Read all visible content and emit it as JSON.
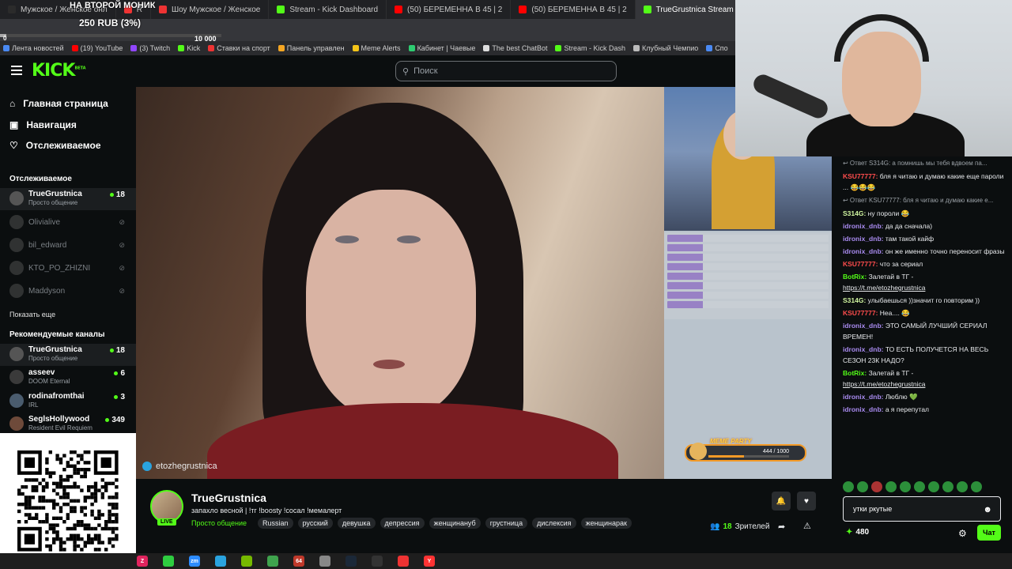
{
  "browser": {
    "tabs": [
      {
        "label": "Мужское / Женское онл",
        "fav_color": "#2b2b2b"
      },
      {
        "label": "R",
        "fav_color": "#e33"
      },
      {
        "label": "Шоу Мужское / Женское",
        "fav_color": "#e33"
      },
      {
        "label": "Stream - Kick Dashboard",
        "fav_color": "#53fc18"
      },
      {
        "label": "(50) БЕРЕМЕННА В 45 | 2",
        "fav_color": "#ff0000"
      },
      {
        "label": "(50) БЕРЕМЕННА В 45 | 2",
        "fav_color": "#ff0000"
      },
      {
        "label": "TrueGrustnica Stream",
        "fav_color": "#53fc18",
        "active": true
      }
    ],
    "bookmarks": [
      {
        "label": "Лента новостей",
        "color": "#4a8af4"
      },
      {
        "label": "(19) YouTube",
        "color": "#ff0000"
      },
      {
        "label": "(3) Twitch",
        "color": "#9146ff"
      },
      {
        "label": "Kick",
        "color": "#53fc18"
      },
      {
        "label": "Ставки на спорт",
        "color": "#e33"
      },
      {
        "label": "Панель управлен",
        "color": "#f5a623"
      },
      {
        "label": "Meme Alerts",
        "color": "#f5c518"
      },
      {
        "label": "Кабинет | Чаевые",
        "color": "#2ecc71"
      },
      {
        "label": "The best ChatBot",
        "color": "#ddd"
      },
      {
        "label": "Stream - Kick Dash",
        "color": "#53fc18"
      },
      {
        "label": "Клубный Чемпио",
        "color": "#bbb"
      },
      {
        "label": "Спо",
        "color": "#4a8af4"
      }
    ]
  },
  "donation": {
    "title": "НА ВТОРОЙ МОНИК",
    "amount": "250 RUB (3%)",
    "min": "0",
    "max": "10 000",
    "progress": 0.03
  },
  "header": {
    "logo": "KICK",
    "logo_sup": "BETA",
    "search_placeholder": "Поиск"
  },
  "sidebar": {
    "nav": [
      "Главная страница",
      "Навигация",
      "Отслеживаемое"
    ],
    "following_title": "Отслеживаемое",
    "following": [
      {
        "name": "TrueGrustnica",
        "category": "Просто общение",
        "viewers": "18",
        "live": true
      },
      {
        "name": "Olivialive",
        "live": false
      },
      {
        "name": "bil_edward",
        "live": false
      },
      {
        "name": "KTO_PO_ZHIZNI",
        "live": false
      },
      {
        "name": "Maddyson",
        "live": false
      }
    ],
    "show_more": "Показать еще",
    "recommended_title": "Рекомендуемые каналы",
    "recommended": [
      {
        "name": "TrueGrustnica",
        "category": "Просто общение",
        "viewers": "18"
      },
      {
        "name": "asseev",
        "category": "DOOM Eternal",
        "viewers": "6"
      },
      {
        "name": "rodinafromthai",
        "category": "IRL",
        "viewers": "3"
      },
      {
        "name": "SeglsHollywood",
        "category": "Resident Evil Requiem",
        "viewers": "349"
      }
    ]
  },
  "video": {
    "channel_overlay": "etozhegrustnica",
    "meme_widget_label": "MEME PARTY",
    "meme_widget_count": "444 / 1000",
    "meme_widget_progress": 0.444
  },
  "stream_info": {
    "channel": "TrueGrustnica",
    "live_badge": "LIVE",
    "title": "запахло весной | !тг !boosty !сосал !мемалерт",
    "category": "Просто общение",
    "tags": [
      "Russian",
      "русский",
      "девушка",
      "депрессия",
      "женщинануб",
      "грустница",
      "дислексия",
      "женщинарак"
    ],
    "viewers_count": "18",
    "viewers_label": "Зрителей"
  },
  "chat": {
    "messages": [
      {
        "reply": "Ответ S314G: а помнишь мы тебя вдвоем па..."
      },
      {
        "user": "KSU77777",
        "color": "#ff4d4d",
        "text": "бля я читаю и думаю какие еще пароли ... 😂😂😂"
      },
      {
        "reply": "Ответ KSU77777: бля я читаю и думаю какие е..."
      },
      {
        "user": "S314G",
        "color": "#d0f5a0",
        "text": "ну пороли 😂"
      },
      {
        "user": "idronix_dnb",
        "color": "#a98bf0",
        "text": "да да сначала)"
      },
      {
        "user": "idronix_dnb",
        "color": "#a98bf0",
        "text": "там такой кайф"
      },
      {
        "user": "idronix_dnb",
        "color": "#a98bf0",
        "text": "он же именно точно переносит фразы"
      },
      {
        "user": "KSU77777",
        "color": "#ff4d4d",
        "text": "что за сериал"
      },
      {
        "user": "BotRix",
        "color": "#53fc18",
        "text": "Залетай в ТГ -",
        "link": "https://t.me/etozhegrustnica"
      },
      {
        "user": "S314G",
        "color": "#d0f5a0",
        "text": "улыбаешься ))значит го повторим ))"
      },
      {
        "user": "KSU77777",
        "color": "#ff4d4d",
        "text": "Неа.... 😂"
      },
      {
        "user": "idronix_dnb",
        "color": "#a98bf0",
        "text": "ЭТО САМЫЙ ЛУЧШИЙ СЕРИАЛ ВРЕМЕН!"
      },
      {
        "user": "idronix_dnb",
        "color": "#a98bf0",
        "text": "ТО ЕСТЬ ПОЛУЧЕТСЯ НА ВЕСЬ СЕЗОН 23К НАДО?"
      },
      {
        "user": "BotRix",
        "color": "#53fc18",
        "text": "Залетай в ТГ -",
        "link": "https://t.me/etozhegrustnica"
      },
      {
        "user": "idronix_dnb",
        "color": "#a98bf0",
        "text": "Люблю 💚"
      },
      {
        "user": "idronix_dnb",
        "color": "#a98bf0",
        "text": "а я перепутал"
      }
    ],
    "input_value": "утки ркутые",
    "points": "480",
    "send_label": "Чат"
  },
  "taskbar": {
    "apps": [
      {
        "label": "Z",
        "color": "#e0245e"
      },
      {
        "label": "",
        "color": "#2ecc40"
      },
      {
        "label": "zm",
        "color": "#2d8cff"
      },
      {
        "label": "",
        "color": "#2aa3df"
      },
      {
        "label": "",
        "color": "#76b900"
      },
      {
        "label": "",
        "color": "#3fa34d"
      },
      {
        "label": "64",
        "color": "#c0392b"
      },
      {
        "label": "",
        "color": "#888"
      },
      {
        "label": "",
        "color": "#1b2838"
      },
      {
        "label": "",
        "color": "#333"
      },
      {
        "label": "",
        "color": "#e33"
      },
      {
        "label": "Y",
        "color": "#ff3333"
      }
    ]
  }
}
